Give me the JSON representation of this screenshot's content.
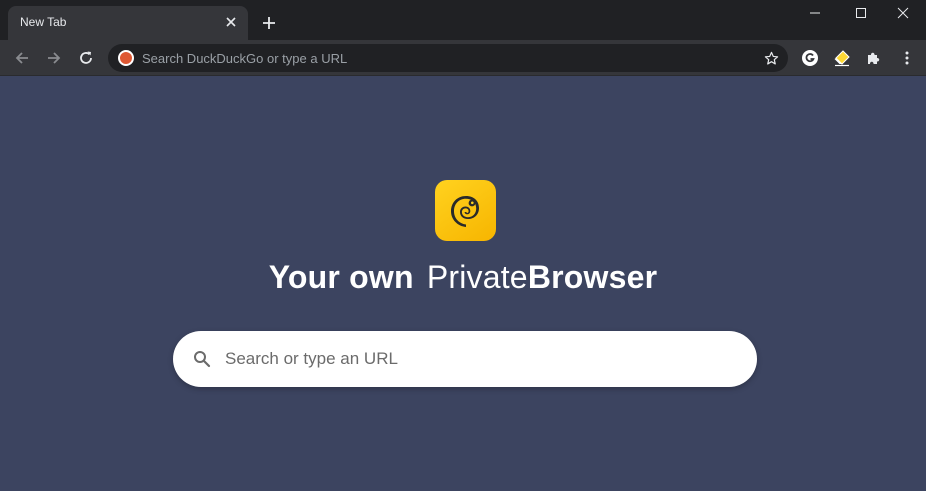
{
  "tab": {
    "title": "New Tab"
  },
  "omnibox": {
    "placeholder": "Search DuckDuckGo or type a URL"
  },
  "icons": {
    "tab_close": "close-icon",
    "new_tab": "plus-icon",
    "back": "arrow-left-icon",
    "forward": "arrow-right-icon",
    "reload": "reload-icon",
    "search_engine": "duckduckgo-icon",
    "bookmark": "star-icon",
    "extension_1": "grammarly-icon",
    "extension_2": "eraser-icon",
    "extensions": "puzzle-icon",
    "menu": "kebab-menu-icon"
  },
  "headline": {
    "part1": "Your own",
    "part2": "Private",
    "part3": "Browser"
  },
  "search": {
    "placeholder": "Search or type an URL"
  },
  "colors": {
    "page_bg": "#3c4460",
    "logo": "#ffc90e",
    "titlebar": "#202124",
    "toolbar": "#35363a"
  }
}
